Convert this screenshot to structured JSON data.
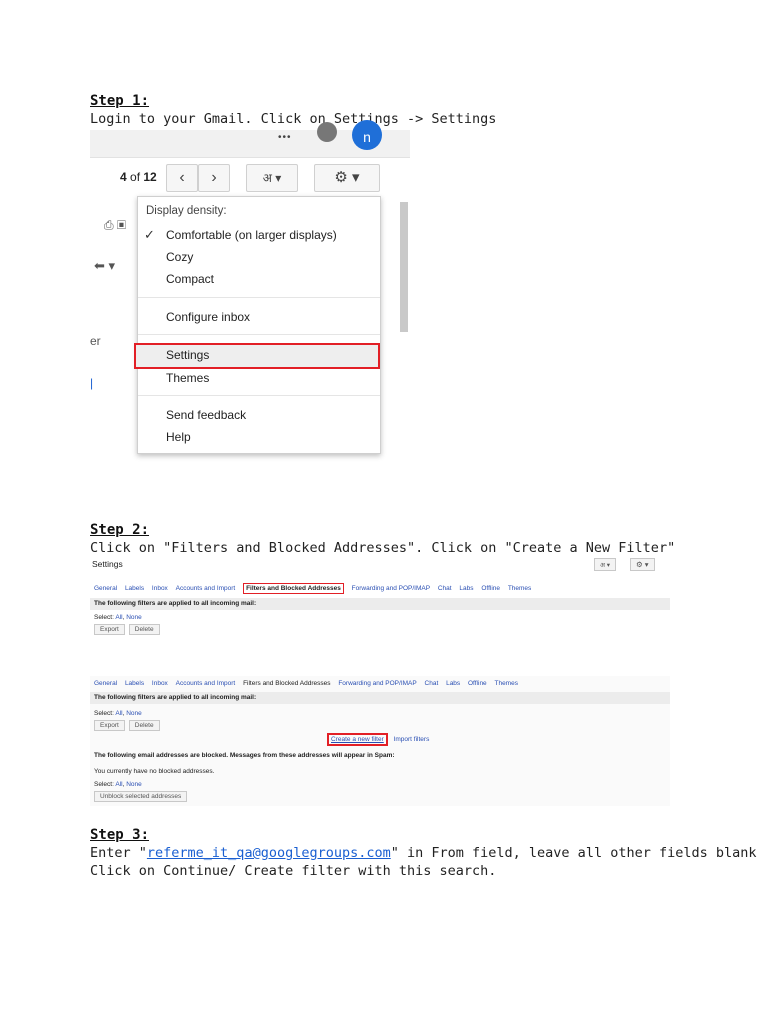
{
  "steps": {
    "s1": {
      "title": "Step 1:",
      "line1": "Login to your Gmail. Click on Settings -> Settings"
    },
    "s2": {
      "title": "Step 2:",
      "line1": "Click on \"Filters and Blocked Addresses\". Click on \"Create a New Filter\""
    },
    "s3": {
      "title": "Step 3:",
      "line1_prefix": "Enter \"",
      "line1_link": "referme_it_qa@googlegroups.com",
      "line1_suffix": "\" in From field, leave all other fields blank",
      "line2": "Click on Continue/ Create filter with this search."
    }
  },
  "shot1": {
    "avatar_letter": "n",
    "dots": "•••",
    "count_prefix": "4",
    "count_mid": " of ",
    "count_total": "12",
    "prev": "‹",
    "next": "›",
    "lang": "अ ▾",
    "gear": "⚙ ▾",
    "menu": {
      "header": "Display density:",
      "check": "✓",
      "comfortable": "Comfortable (on larger displays)",
      "cozy": "Cozy",
      "compact": "Compact",
      "configure": "Configure inbox",
      "settings": "Settings",
      "themes": "Themes",
      "feedback": "Send feedback",
      "help": "Help"
    },
    "left_partial_1": "er",
    "left_partial_2": "|",
    "left_icons": "⎙ ▣",
    "reply_icon": "⬅ ▾"
  },
  "shot2": {
    "title": "Settings",
    "lang": "अ ▾",
    "gear": "⚙ ▾",
    "tabs": [
      "General",
      "Labels",
      "Inbox",
      "Accounts and Import",
      "Filters and Blocked Addresses",
      "Forwarding and POP/IMAP",
      "Chat",
      "Labs",
      "Offline",
      "Themes"
    ],
    "bar": "The following filters are applied to all incoming mail:",
    "select_label": "Select:",
    "select_all": "All",
    "select_none": "None",
    "export": "Export",
    "delete": "Delete"
  },
  "shot3": {
    "tabs": [
      "General",
      "Labels",
      "Inbox",
      "Accounts and Import",
      "Filters and Blocked Addresses",
      "Forwarding and POP/IMAP",
      "Chat",
      "Labs",
      "Offline",
      "Themes"
    ],
    "bar1": "The following filters are applied to all incoming mail:",
    "select_label": "Select:",
    "select_all": "All",
    "select_none": "None",
    "export": "Export",
    "delete": "Delete",
    "create_filter": "Create a new filter",
    "import_filters": "Import filters",
    "bar2": "The following email addresses are blocked. Messages from these addresses will appear in Spam:",
    "no_blocked": "You currently have no blocked addresses.",
    "unblock": "Unblock selected addresses"
  },
  "colors": {
    "highlight_red": "#e21f26",
    "link_blue": "#1a5fd1",
    "avatar_blue": "#1f6fd8"
  }
}
